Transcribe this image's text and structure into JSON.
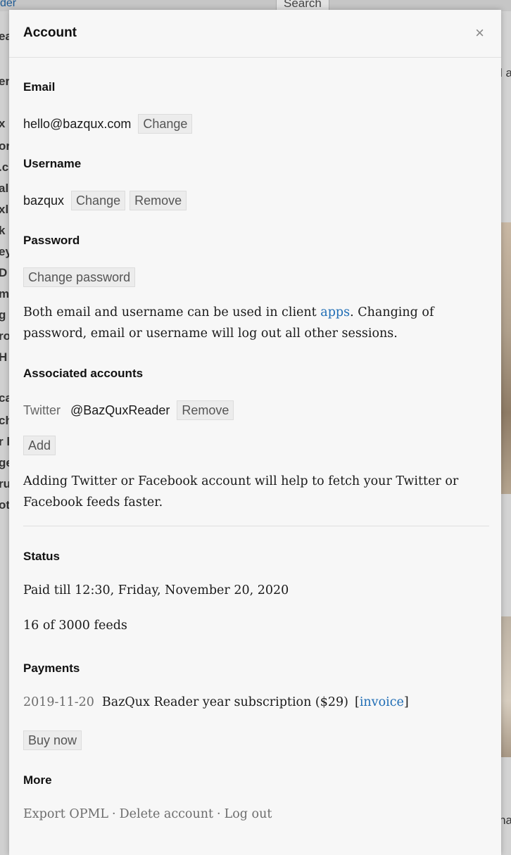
{
  "background": {
    "link_text": "der",
    "search_label": "Search",
    "left_fragments": [
      "ea",
      "er",
      "x",
      "or",
      ".c",
      "al",
      "xl",
      "k",
      "ey",
      "D",
      "m",
      "g",
      "ro",
      "H",
      "ca",
      "ch",
      "r l",
      "ge",
      "ru",
      "ot"
    ],
    "right_fragments": [
      "l a",
      "ha"
    ]
  },
  "modal": {
    "title": "Account",
    "close_glyph": "×"
  },
  "email": {
    "heading": "Email",
    "value": "hello@bazqux.com",
    "change_label": "Change"
  },
  "username": {
    "heading": "Username",
    "value": "bazqux",
    "change_label": "Change",
    "remove_label": "Remove"
  },
  "password": {
    "heading": "Password",
    "change_label": "Change password",
    "note_before": "Both email and username can be used in client ",
    "note_link": "apps",
    "note_after": ". Changing of password, email or username will log out all other sessions."
  },
  "associated": {
    "heading": "Associated accounts",
    "service": "Twitter",
    "handle": "@BazQuxReader",
    "remove_label": "Remove",
    "add_label": "Add",
    "note": "Adding Twitter or Facebook account will help to fetch your Twitter or Facebook feeds faster."
  },
  "status": {
    "heading": "Status",
    "paid_till": "Paid till 12:30, Friday, November 20, 2020",
    "feeds": "16 of 3000 feeds"
  },
  "payments": {
    "heading": "Payments",
    "date": "2019-11-20",
    "description": "BazQux Reader year subscription ($29)",
    "bracket_open": "[",
    "invoice_label": "invoice",
    "bracket_close": "]",
    "buy_label": "Buy now"
  },
  "more": {
    "heading": "More",
    "export_label": "Export OPML",
    "separator": "·",
    "delete_label": "Delete account",
    "logout_label": "Log out"
  },
  "colors": {
    "link": "#1f6db5",
    "background": "#f7f7f7",
    "button_bg": "#ececec"
  }
}
